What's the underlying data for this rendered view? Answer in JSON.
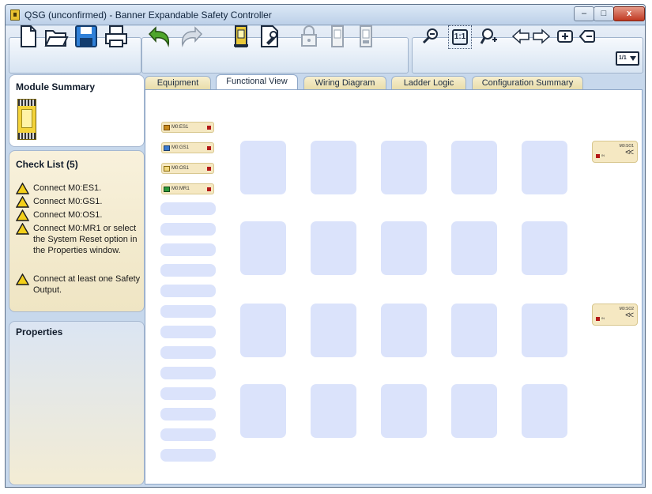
{
  "window": {
    "title": "QSG (unconfirmed) - Banner Expandable Safety Controller",
    "controls": {
      "minimize": "–",
      "maximize": "□",
      "close": "x"
    }
  },
  "toolbar": {
    "icons": [
      "new-file-icon",
      "open-folder-icon",
      "save-icon",
      "print-icon",
      "undo-icon",
      "redo-icon",
      "controller-icon",
      "configure-icon",
      "lock-icon",
      "module-icon",
      "module-disabled-icon",
      "zoom-out-icon",
      "zoom-actual-icon",
      "zoom-in-icon",
      "arrow-left-icon",
      "arrow-right-icon",
      "add-page-icon",
      "remove-page-icon",
      "page-select-icon"
    ],
    "zoom_actual_label": "1:1",
    "page_select_value": "1/1"
  },
  "sidebar": {
    "module_summary": {
      "title": "Module Summary"
    },
    "check_list": {
      "title": "Check List (5)",
      "items": [
        "Connect M0:ES1.",
        "Connect M0:GS1.",
        "Connect M0:OS1.",
        "Connect M0:MR1 or select the System Reset option in the Properties window.",
        "Connect at least one Safety Output."
      ]
    },
    "splitter": ".....",
    "properties": {
      "title": "Properties"
    }
  },
  "tabs": [
    {
      "label": "Equipment",
      "active": false
    },
    {
      "label": "Functional View",
      "active": true
    },
    {
      "label": "Wiring Diagram",
      "active": false
    },
    {
      "label": "Ladder Logic",
      "active": false
    },
    {
      "label": "Configuration Summary",
      "active": false
    }
  ],
  "canvas": {
    "inputs": [
      "M0:ES1",
      "M0:GS1",
      "M0:OS1",
      "M0:MR1"
    ],
    "outputs": [
      {
        "label": "M0:SO1",
        "in_label": "IN"
      },
      {
        "label": "M0:SO2",
        "in_label": "IN"
      }
    ],
    "empty_input_slots": 13,
    "logic_block_rows": 4,
    "logic_block_cols": 5
  },
  "colors": {
    "title_bar": "#c7d8ec",
    "tab_inactive": "#efe3b8",
    "slot": "#dbe3fb",
    "led_red": "#b41818",
    "node_bg": "#f5e8c2"
  }
}
